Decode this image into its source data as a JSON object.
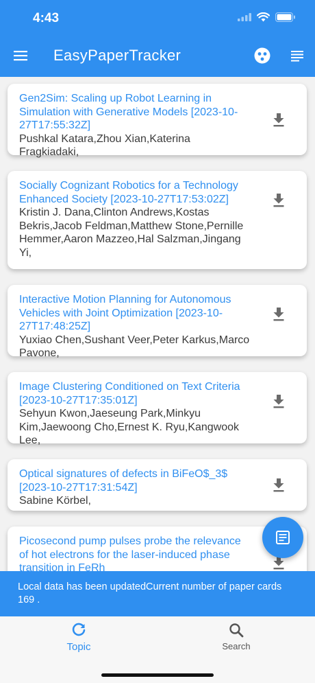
{
  "status_bar": {
    "time": "4:43"
  },
  "app": {
    "title": "EasyPaperTracker"
  },
  "cards": [
    {
      "title": "Gen2Sim: Scaling up Robot Learning in Simulation with Generative Models [2023-10-27T17:55:32Z]",
      "authors": "Pushkal Katara,Zhou Xian,Katerina Fragkiadaki,"
    },
    {
      "title": "Socially Cognizant Robotics for a Technology Enhanced Society [2023-10-27T17:53:02Z]",
      "authors": "Kristin J. Dana,Clinton Andrews,Kostas Bekris,Jacob Feldman,Matthew Stone,Pernille Hemmer,Aaron Mazzeo,Hal Salzman,Jingang Yi,"
    },
    {
      "title": "Interactive Motion Planning for Autonomous Vehicles with Joint   Optimization [2023-10-27T17:48:25Z]",
      "authors": "Yuxiao Chen,Sushant Veer,Peter Karkus,Marco Pavone,"
    },
    {
      "title": "Image Clustering Conditioned on Text Criteria [2023-10-27T17:35:01Z]",
      "authors": "Sehyun Kwon,Jaeseung Park,Minkyu Kim,Jaewoong Cho,Ernest K. Ryu,Kangwook Lee,"
    },
    {
      "title": "Optical signatures of defects in BiFeO$_3$ [2023-10-27T17:31:54Z]",
      "authors": "Sabine Körbel,"
    },
    {
      "title": "Picosecond pump pulses probe the relevance of hot electrons for the   laser-induced phase transition in FeRh",
      "authors": ""
    }
  ],
  "snackbar": {
    "message": "Local data has been updatedCurrent number of paper cards 169 ."
  },
  "bottom_nav": {
    "topic_label": "Topic",
    "search_label": "Search"
  },
  "colors": {
    "accent": "#2f8ff0",
    "text": "#3b3b3b",
    "background": "#f2f2f2"
  },
  "icons": [
    "menu-icon",
    "face-icon",
    "list-icon",
    "download-icon",
    "notes-icon",
    "refresh-icon",
    "search-icon"
  ]
}
